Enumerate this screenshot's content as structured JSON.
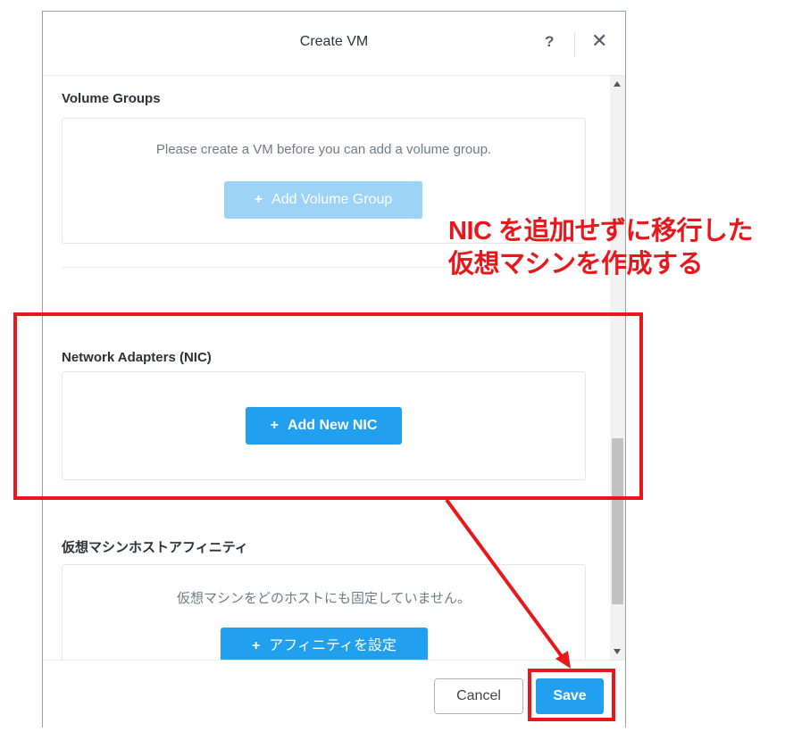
{
  "dialog": {
    "title": "Create VM",
    "help_icon": "?",
    "close_icon": "✕"
  },
  "volume_groups": {
    "title": "Volume Groups",
    "message": "Please create a VM before you can add a volume group.",
    "button_label": "Add Volume Group",
    "button_icon": "+"
  },
  "network_adapters": {
    "title": "Network Adapters (NIC)",
    "button_label": "Add New NIC",
    "button_icon": "+"
  },
  "host_affinity": {
    "title": "仮想マシンホストアフィニティ",
    "message": "仮想マシンをどのホストにも固定していません。",
    "button_label": "アフィニティを設定",
    "button_icon": "+"
  },
  "footer": {
    "cancel_label": "Cancel",
    "save_label": "Save"
  },
  "annotation": {
    "line1": "NIC を追加せずに移行した",
    "line2": "仮想マシンを作成する",
    "color": "#e8171b"
  },
  "colors": {
    "primary": "#21a0f0",
    "primary_disabled": "#9dd3f7"
  }
}
